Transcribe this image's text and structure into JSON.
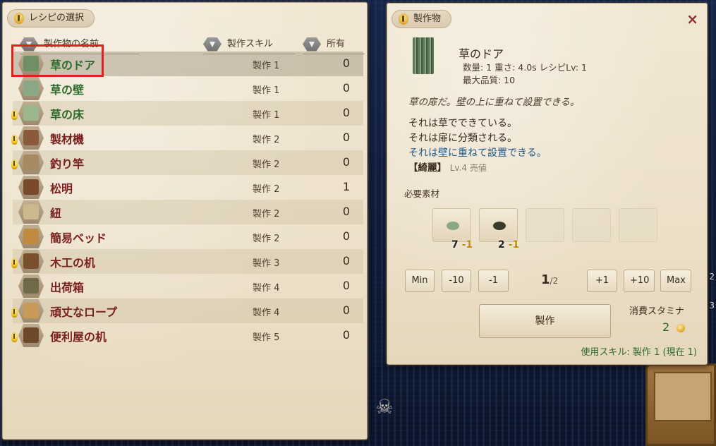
{
  "background": {
    "edge_numbers": [
      "2",
      "3"
    ]
  },
  "recipe_panel": {
    "title": "レシピの選択",
    "columns": {
      "name": "製作物の名前",
      "skill": "製作スキル",
      "owned": "所有"
    },
    "items": [
      {
        "name": "草のドア",
        "skill": "製作 1",
        "owned": "0",
        "color": "green",
        "bulb": false,
        "icon_color": "#6f8f66",
        "selected": true
      },
      {
        "name": "草の壁",
        "skill": "製作 1",
        "owned": "0",
        "color": "green",
        "bulb": false,
        "icon_color": "#8aa886"
      },
      {
        "name": "草の床",
        "skill": "製作 1",
        "owned": "0",
        "color": "green",
        "bulb": true,
        "icon_color": "#9bb58c"
      },
      {
        "name": "製材機",
        "skill": "製作 2",
        "owned": "0",
        "color": "red",
        "bulb": true,
        "icon_color": "#8a5a3a"
      },
      {
        "name": "釣り竿",
        "skill": "製作 2",
        "owned": "0",
        "color": "red",
        "bulb": true,
        "icon_color": "#a88a60"
      },
      {
        "name": "松明",
        "skill": "製作 2",
        "owned": "1",
        "color": "red",
        "bulb": false,
        "icon_color": "#7a4a2a"
      },
      {
        "name": "紐",
        "skill": "製作 2",
        "owned": "0",
        "color": "red",
        "bulb": false,
        "icon_color": "#c9b98c"
      },
      {
        "name": "簡易ベッド",
        "skill": "製作 2",
        "owned": "0",
        "color": "red",
        "bulb": false,
        "icon_color": "#c08a40"
      },
      {
        "name": "木工の机",
        "skill": "製作 3",
        "owned": "0",
        "color": "red",
        "bulb": true,
        "icon_color": "#7a4f2c"
      },
      {
        "name": "出荷箱",
        "skill": "製作 4",
        "owned": "0",
        "color": "red",
        "bulb": false,
        "icon_color": "#6f6a48"
      },
      {
        "name": "頑丈なロープ",
        "skill": "製作 4",
        "owned": "0",
        "color": "red",
        "bulb": true,
        "icon_color": "#c89a5a"
      },
      {
        "name": "便利屋の机",
        "skill": "製作 5",
        "owned": "0",
        "color": "red",
        "bulb": true,
        "icon_color": "#6f4a2a"
      }
    ]
  },
  "product_panel": {
    "title": "製作物",
    "close_label": "×",
    "name": "草のドア",
    "stats_line1": "数量: 1  重さ: 4.0s  レシピLv: 1",
    "stats_line2": "最大品質: 10",
    "description": "草の扉だ。壁の上に重ねて設置できる。",
    "trait1": "それは草でできている。",
    "trait2": "それは扉に分類される。",
    "trait3": "それは壁に重ねて設置できる。",
    "quality_tag": "【綺麗】",
    "quality_value": "Lv.4 売値",
    "required_label": "必要素材",
    "materials": [
      {
        "qty": "7",
        "consume": "-1",
        "icon_color": "#8aa886"
      },
      {
        "qty": "2",
        "consume": "-1",
        "icon_color": "#3a3a2a"
      }
    ],
    "buttons": {
      "min": "Min",
      "minus10": "-10",
      "minus1": "-1",
      "plus1": "+1",
      "plus10": "+10",
      "max": "Max"
    },
    "counter_current": "1",
    "counter_total": "/2",
    "craft_label": "製作",
    "stamina_label": "消費スタミナ",
    "stamina_value": "2",
    "skill_used": "使用スキル: 製作 1 (現在 1)"
  }
}
